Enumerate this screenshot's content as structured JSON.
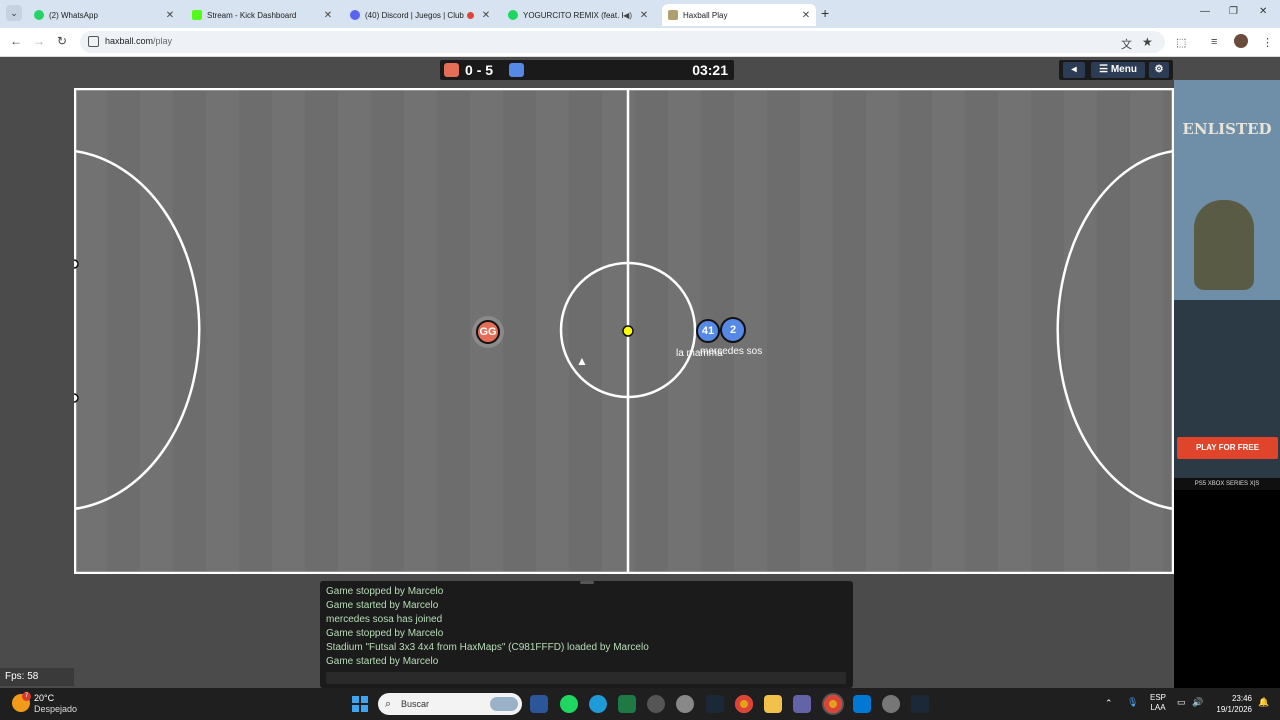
{
  "browser": {
    "tabs": [
      {
        "title": "(2) WhatsApp",
        "favicon_color": "#25d366"
      },
      {
        "title": "Stream - Kick Dashboard",
        "favicon_color": "#53fc18"
      },
      {
        "title": "(40) Discord | Juegos | Club",
        "favicon_color": "#5865f2"
      },
      {
        "title": "YOGURCITO REMIX (feat. K",
        "favicon_color": "#1ed760"
      },
      {
        "title": "Haxball Play",
        "favicon_color": "#b0a070"
      }
    ],
    "active_tab_index": 4,
    "url_host": "haxball.com",
    "url_path": "/play"
  },
  "game": {
    "red_score": "0",
    "separator": "-",
    "blue_score": "5",
    "timer": "03:21",
    "red_color": "#e56e56",
    "blue_color": "#5689e5",
    "menu_label": "Menu",
    "players": [
      {
        "avatar": "GG",
        "team": "red"
      },
      {
        "avatar": "41",
        "team": "blue",
        "name": "la mamma"
      },
      {
        "avatar": "2",
        "team": "blue",
        "name": "mercedes sos"
      }
    ]
  },
  "chat": {
    "messages": [
      "Game stopped by Marcelo",
      "Game started by Marcelo",
      "mercedes sosa has joined",
      "Game stopped by Marcelo",
      "Stadium \"Futsal 3x3 4x4 from HaxMaps\" (C981FFFD) loaded by Marcelo",
      "Game started by Marcelo"
    ]
  },
  "fps": "Fps: 58",
  "ad": {
    "logo": "ENLISTED",
    "cta": "PLAY FOR FREE",
    "platforms": "PS5  XBOX SERIES X|S"
  },
  "taskbar": {
    "temperature": "20°C",
    "weather": "Despejado",
    "weather_badge": "7",
    "search_placeholder": "Buscar",
    "lang_line1": "ESP",
    "lang_line2": "LAA",
    "time": "23:46",
    "date": "19/1/2026"
  }
}
